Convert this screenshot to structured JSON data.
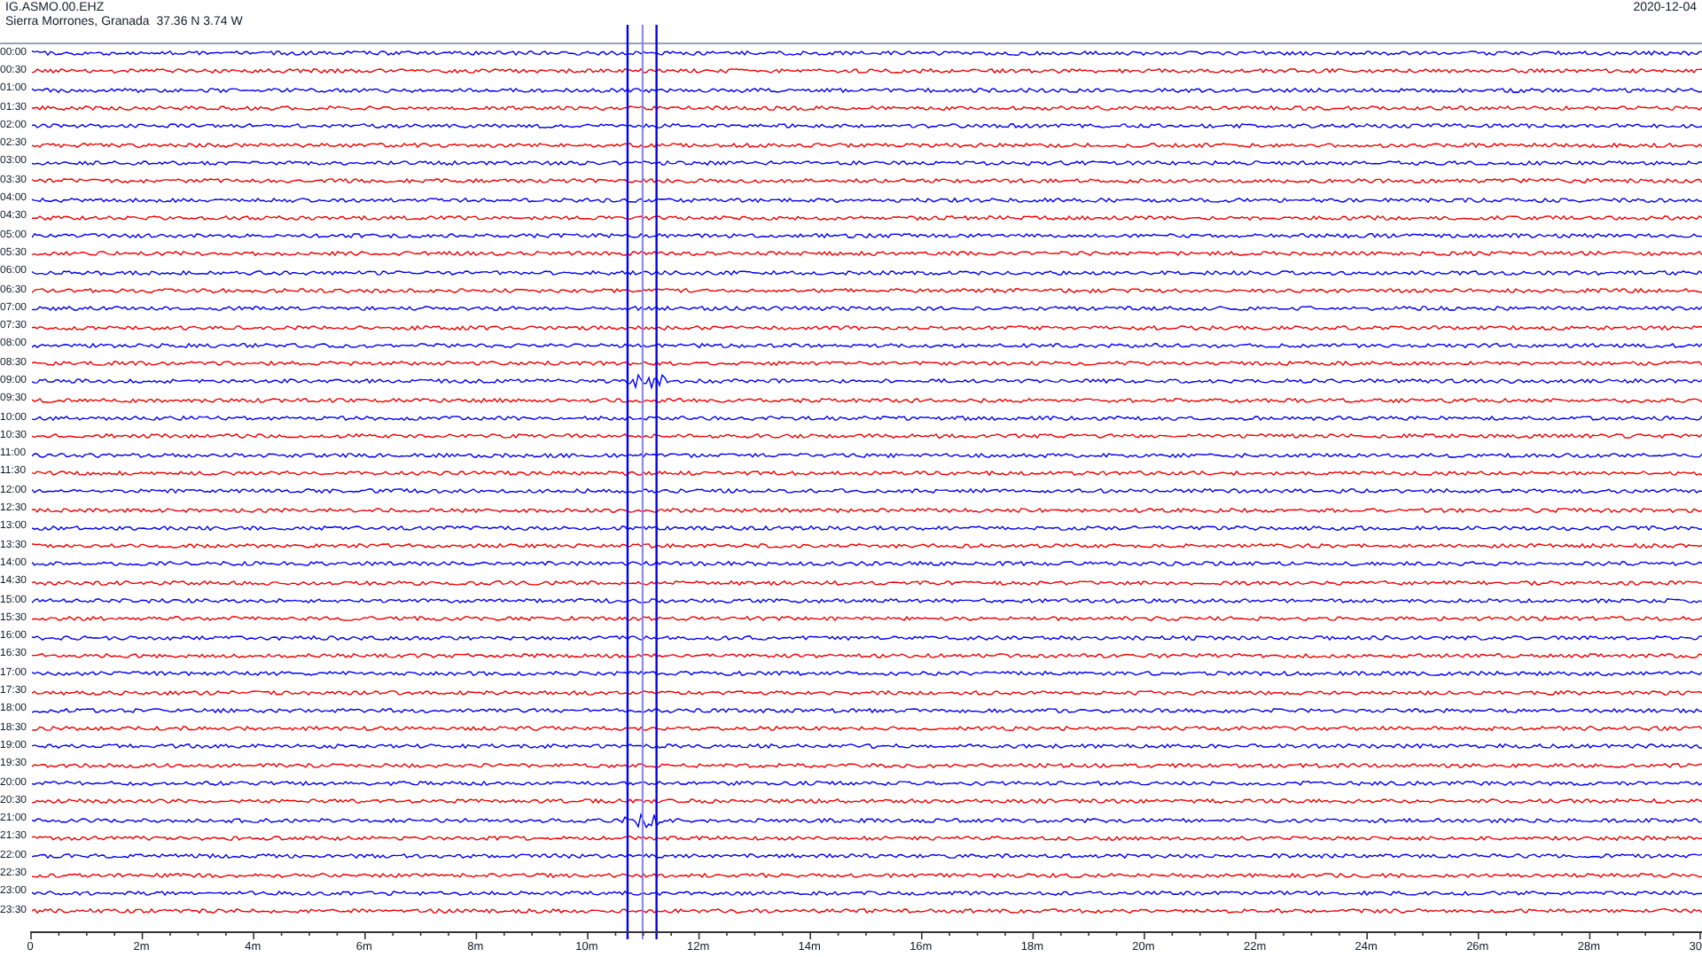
{
  "header": {
    "station": "IG.ASMO.00.EHZ",
    "location": "Sierra Morrones, Granada  37.36 N 3.74 W",
    "date": "2020-12-04"
  },
  "rows": [
    {
      "time": "00:00",
      "color": "#0000ee"
    },
    {
      "time": "00:30",
      "color": "#ee0000"
    },
    {
      "time": "01:00",
      "color": "#0000ee"
    },
    {
      "time": "01:30",
      "color": "#ee0000"
    },
    {
      "time": "02:00",
      "color": "#0000ee"
    },
    {
      "time": "02:30",
      "color": "#ee0000"
    },
    {
      "time": "03:00",
      "color": "#0000ee"
    },
    {
      "time": "03:30",
      "color": "#ee0000"
    },
    {
      "time": "04:00",
      "color": "#0000ee"
    },
    {
      "time": "04:30",
      "color": "#ee0000"
    },
    {
      "time": "05:00",
      "color": "#0000ee"
    },
    {
      "time": "05:30",
      "color": "#ee0000"
    },
    {
      "time": "06:00",
      "color": "#0000ee"
    },
    {
      "time": "06:30",
      "color": "#ee0000"
    },
    {
      "time": "07:00",
      "color": "#0000ee"
    },
    {
      "time": "07:30",
      "color": "#ee0000"
    },
    {
      "time": "08:00",
      "color": "#0000ee"
    },
    {
      "time": "08:30",
      "color": "#ee0000"
    },
    {
      "time": "09:00",
      "color": "#0000ee"
    },
    {
      "time": "09:30",
      "color": "#ee0000"
    },
    {
      "time": "10:00",
      "color": "#0000ee"
    },
    {
      "time": "10:30",
      "color": "#ee0000"
    },
    {
      "time": "11:00",
      "color": "#0000ee"
    },
    {
      "time": "11:30",
      "color": "#ee0000"
    },
    {
      "time": "12:00",
      "color": "#0000ee"
    },
    {
      "time": "12:30",
      "color": "#ee0000"
    },
    {
      "time": "13:00",
      "color": "#0000ee"
    },
    {
      "time": "13:30",
      "color": "#ee0000"
    },
    {
      "time": "14:00",
      "color": "#0000ee"
    },
    {
      "time": "14:30",
      "color": "#ee0000"
    },
    {
      "time": "15:00",
      "color": "#0000ee"
    },
    {
      "time": "15:30",
      "color": "#ee0000"
    },
    {
      "time": "16:00",
      "color": "#0000ee"
    },
    {
      "time": "16:30",
      "color": "#ee0000"
    },
    {
      "time": "17:00",
      "color": "#0000ee"
    },
    {
      "time": "17:30",
      "color": "#ee0000"
    },
    {
      "time": "18:00",
      "color": "#0000ee"
    },
    {
      "time": "18:30",
      "color": "#ee0000"
    },
    {
      "time": "19:00",
      "color": "#0000ee"
    },
    {
      "time": "19:30",
      "color": "#ee0000"
    },
    {
      "time": "20:00",
      "color": "#0000ee"
    },
    {
      "time": "20:30",
      "color": "#ee0000"
    },
    {
      "time": "21:00",
      "color": "#0000ee"
    },
    {
      "time": "21:30",
      "color": "#ee0000"
    },
    {
      "time": "22:00",
      "color": "#0000ee"
    },
    {
      "time": "22:30",
      "color": "#ee0000"
    },
    {
      "time": "23:00",
      "color": "#0000ee"
    },
    {
      "time": "23:30",
      "color": "#ee0000"
    }
  ],
  "x_axis": {
    "ticks": [
      "0",
      "2m",
      "4m",
      "6m",
      "8m",
      "10m",
      "12m",
      "14m",
      "16m",
      "18m",
      "20m",
      "22m",
      "24m",
      "26m",
      "28m",
      "30"
    ]
  }
}
